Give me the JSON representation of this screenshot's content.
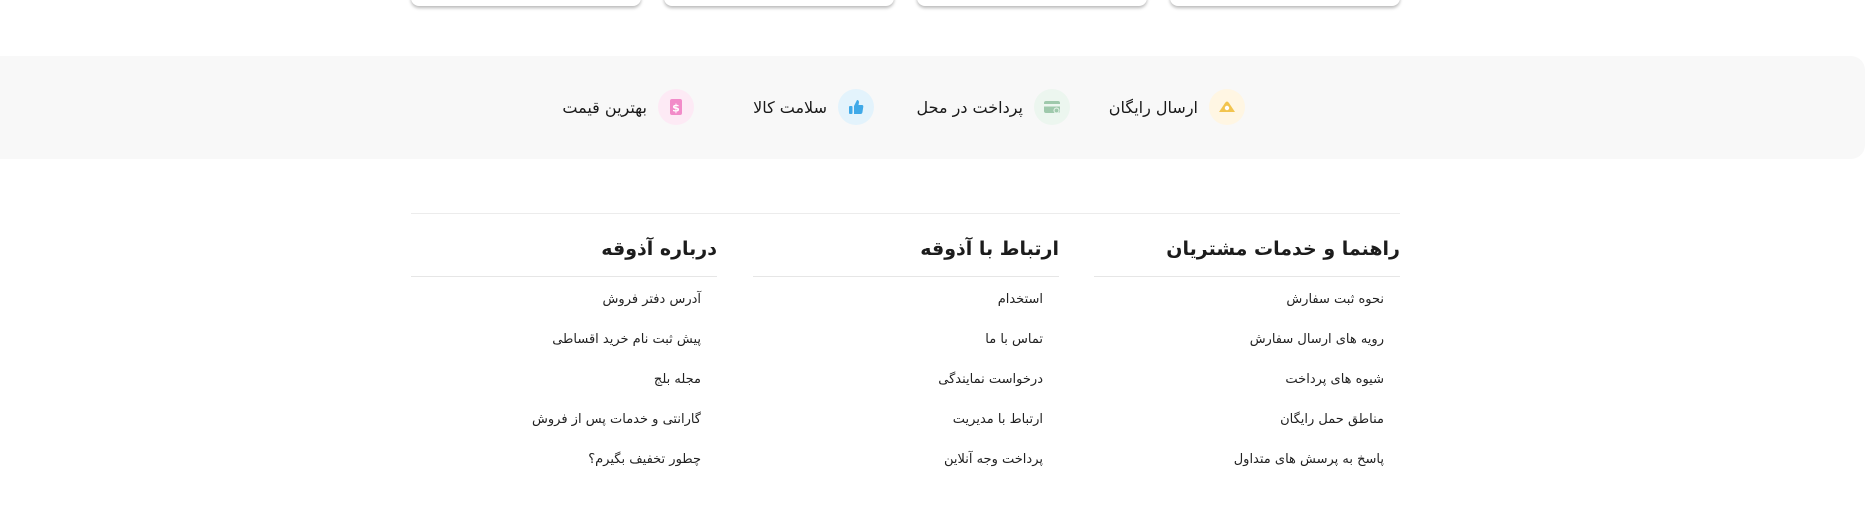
{
  "features": [
    {
      "label": "ارسال رایگان",
      "icon": "truck-icon",
      "circle_color": "#fff6e3",
      "icon_color": "#f2c44e"
    },
    {
      "label": "پرداخت در محل",
      "icon": "card-icon",
      "circle_color": "#ecf6ef",
      "icon_color": "#9fc9ac"
    },
    {
      "label": "سلامت کالا",
      "icon": "thumbs-up-icon",
      "circle_color": "#e3f3fc",
      "icon_color": "#3fa9e8"
    },
    {
      "label": "بهترین قیمت",
      "icon": "dollar-icon",
      "circle_color": "#fdeaf5",
      "icon_color": "#f28bc9"
    }
  ],
  "footer": {
    "columns": [
      {
        "title": "راهنما و خدمات مشتریان",
        "links": [
          "نحوه ثبت سفارش",
          "رویه های ارسال سفارش",
          "شیوه های پرداخت",
          "مناطق حمل رایگان",
          "پاسخ به پرسش های متداول"
        ]
      },
      {
        "title": "ارتباط با آذوقه",
        "links": [
          "استخدام",
          "تماس با ما",
          "درخواست نمایندگی",
          "ارتباط با مدیریت",
          "پرداخت وجه آنلاین"
        ]
      },
      {
        "title": "درباره آذوقه",
        "links": [
          "آدرس دفتر فروش",
          "پیش ثبت نام خرید اقساطی",
          "مجله بلج",
          "گارانتی و خدمات پس از فروش",
          "چطور تخفیف بگیرم؟"
        ]
      }
    ]
  }
}
